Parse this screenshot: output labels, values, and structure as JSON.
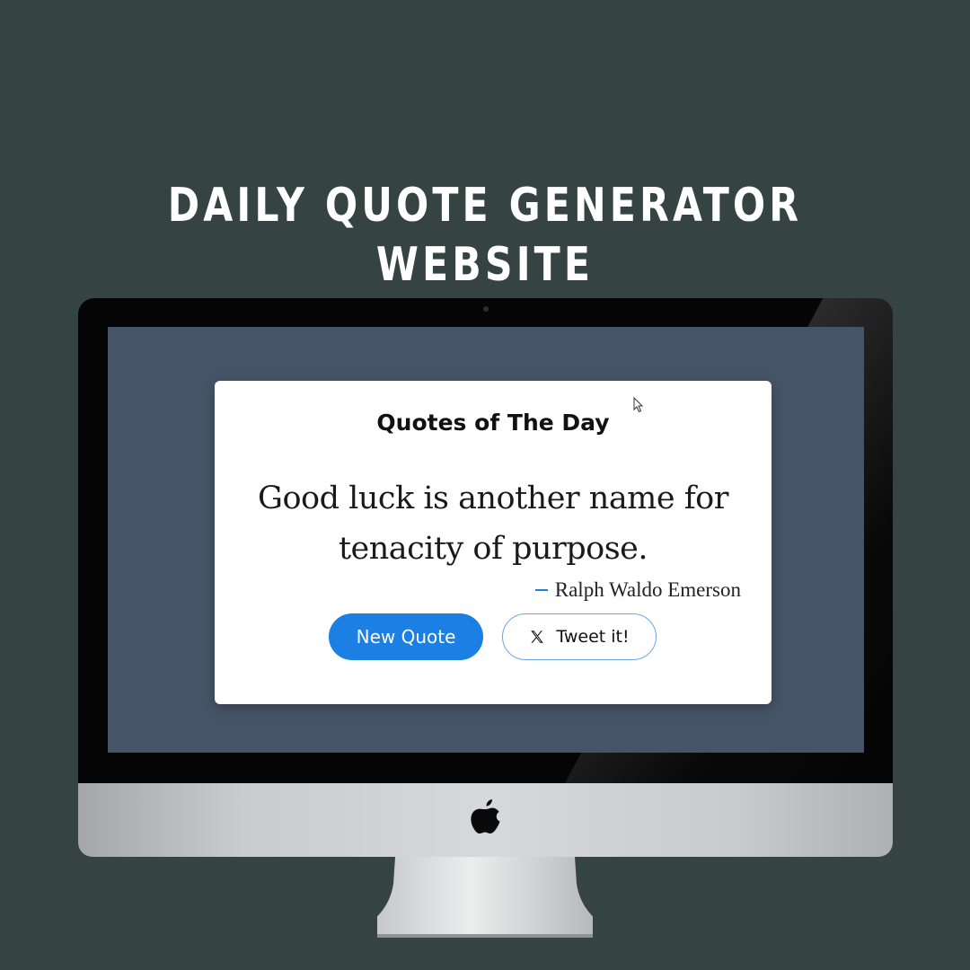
{
  "headline": "DAILY QUOTE GENERATOR WEBSITE",
  "card": {
    "title": "Quotes of The Day",
    "quote": "Good luck is another name for tenacity of purpose.",
    "author": "Ralph Waldo Emerson",
    "new_quote_label": "New Quote",
    "tweet_label": "Tweet it!"
  },
  "icons": {
    "tweet_icon": "x-logo-icon",
    "cursor": "mouse-pointer-icon",
    "monitor_logo": "apple-logo-icon"
  },
  "colors": {
    "background": "#354343",
    "screen": "#465467",
    "accent": "#1c7fe3"
  }
}
